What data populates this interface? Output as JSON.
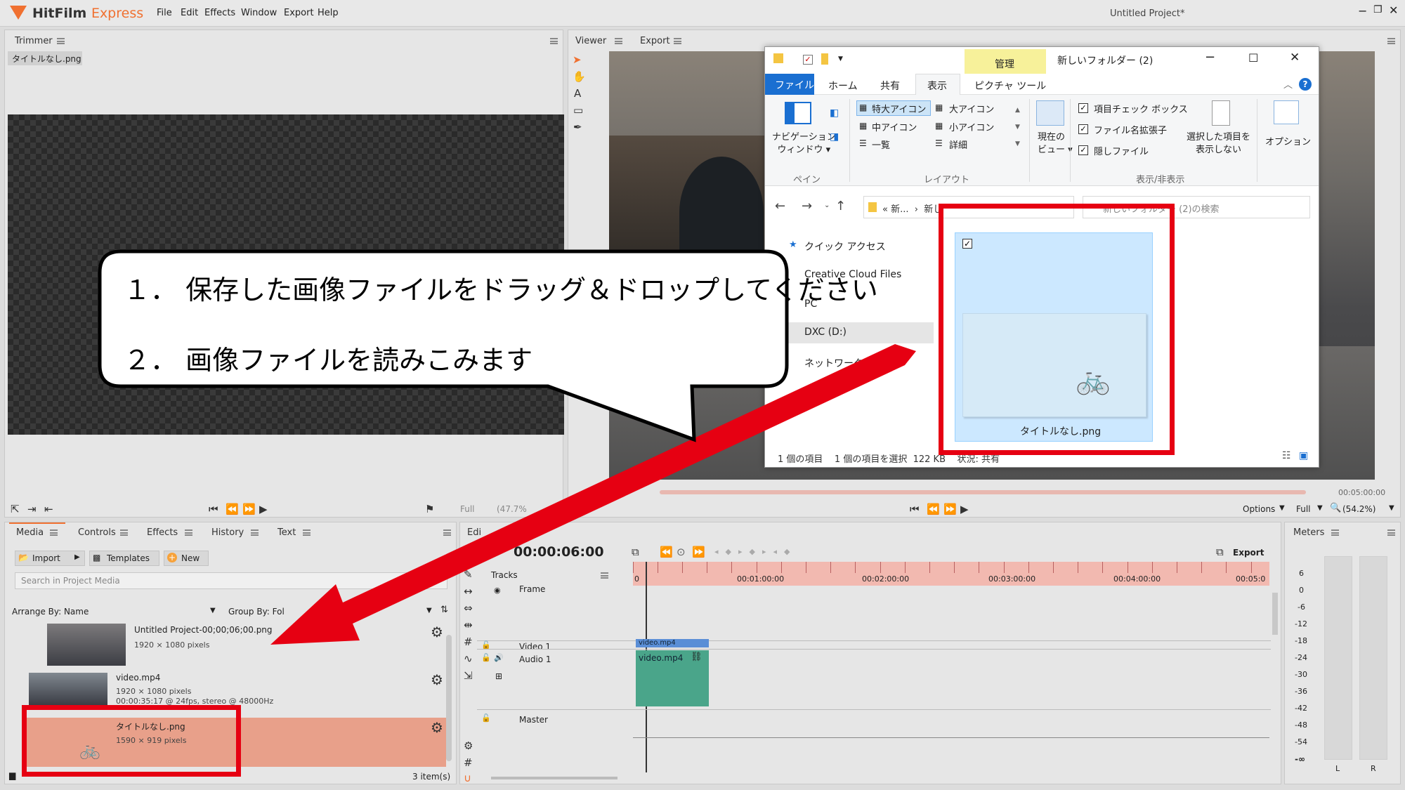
{
  "app": {
    "brand_a": "HitFilm",
    "brand_b": "Express",
    "menu": [
      "File",
      "Edit",
      "Effects",
      "Window",
      "Export",
      "Help"
    ],
    "project_title": "Untitled Project*"
  },
  "trimmer": {
    "tab": "Trimmer",
    "file": "タイトルなし.png"
  },
  "viewer": {
    "tab_viewer": "Viewer",
    "tab_export": "Export",
    "time": "00:05:00:00",
    "options": "Options",
    "full": "Full",
    "zoom": "(54.2%)"
  },
  "trimmer_controls": {
    "full": "Full",
    "zoom": "(47.7%"
  },
  "explorer": {
    "manage": "管理",
    "folder_title": "新しいフォルダー (2)",
    "tabs": [
      "ファイル",
      "ホーム",
      "共有",
      "表示",
      "ピクチャ ツール"
    ],
    "nav_pane": "ナビゲーション\nウィンドウ ▾",
    "pane_group": "ペイン",
    "layout_items": [
      "特大アイコン",
      "大アイコン",
      "中アイコン",
      "小アイコン",
      "一覧",
      "詳細"
    ],
    "layout_group": "レイアウト",
    "current_view": "現在の\nビュー ▾",
    "checkboxes": [
      "項目チェック ボックス",
      "ファイル名拡張子",
      "隠しファイル"
    ],
    "hide_selected": "選択した項目を\n表示しない",
    "options": "オプション",
    "show_hide_group": "表示/非表示",
    "address": "« 新...  ›  新し",
    "search_placeholder": "新しいフォルダー (2)の検索",
    "sidebar": [
      "クイック アクセス",
      "Creative Cloud Files",
      "PC",
      "DXC (D:)",
      "ネットワーク"
    ],
    "file_name": "タイトルなし.png",
    "status": "1 個の項目    1 個の項目を選択  122 KB    状況: 共有"
  },
  "callout": {
    "line1": "１．  保存した画像ファイルをドラッグ＆ドロップしてください",
    "line2": "２．  画像ファイルを読みこみます"
  },
  "media": {
    "tabs": [
      "Media",
      "Controls",
      "Effects",
      "History",
      "Text"
    ],
    "import": "Import",
    "templates": "Templates",
    "new": "New",
    "search_placeholder": "Search in Project Media",
    "arrange": "Arrange By: Name",
    "group": "Group By: Fol",
    "items": [
      {
        "name": "Untitled Project-00;00;06;00.png",
        "meta": "1920 × 1080 pixels",
        "meta2": ""
      },
      {
        "name": "video.mp4",
        "meta": "1920 × 1080 pixels",
        "meta2": "00:00:35:17 @ 24fps, stereo @ 48000Hz"
      },
      {
        "name": "タイトルなし.png",
        "meta": "1590 × 919 pixels",
        "meta2": ""
      }
    ],
    "count": "3 item(s)"
  },
  "editor": {
    "tab": "Edi",
    "time": "00:00:06:00",
    "tracks_label": "Tracks",
    "export": "Export",
    "ruler": [
      "0",
      "00:01:00:00",
      "00:02:00:00",
      "00:03:00:00",
      "00:04:00:00",
      "00:05:0"
    ],
    "track_frame": "Frame",
    "track_video": "Video 1",
    "track_audio": "Audio 1",
    "track_master": "Master",
    "clip_video": "video.mp4",
    "clip_audio": "video.mp4"
  },
  "meters": {
    "tab": "Meters",
    "scale": [
      "6",
      "0",
      "-6",
      "-12",
      "-18",
      "-24",
      "-30",
      "-36",
      "-42",
      "-48",
      "-54",
      "-∞"
    ],
    "left": "L",
    "right": "R"
  }
}
